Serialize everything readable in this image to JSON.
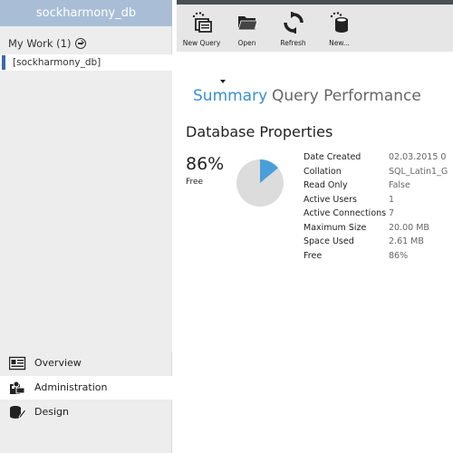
{
  "sidebar": {
    "db_title": "sockharmony_db",
    "my_work_label": "My Work (1)",
    "db_item": "[sockharmony_db]",
    "nav": [
      {
        "label": "Overview",
        "icon": "overview-icon"
      },
      {
        "label": "Administration",
        "icon": "administration-icon"
      },
      {
        "label": "Design",
        "icon": "design-icon"
      }
    ]
  },
  "toolbar": {
    "buttons": [
      {
        "label": "New Query",
        "icon": "new-query-icon"
      },
      {
        "label": "Open",
        "icon": "folder-icon"
      },
      {
        "label": "Refresh",
        "icon": "refresh-icon"
      },
      {
        "label": "New...",
        "icon": "new-database-icon"
      }
    ]
  },
  "main": {
    "tabs": [
      {
        "label": "Summary",
        "active": true
      },
      {
        "label": "Query Performance",
        "active": false
      }
    ],
    "section_title": "Database Properties",
    "free_percent_text": "86%",
    "free_label": "Free",
    "free_fraction": 0.86,
    "properties": [
      {
        "key": "Date Created",
        "value": "02.03.2015 0"
      },
      {
        "key": "Collation",
        "value": "SQL_Latin1_G"
      },
      {
        "key": "Read Only",
        "value": "False"
      },
      {
        "key": "Active Users",
        "value": "1"
      },
      {
        "key": "Active Connections",
        "value": "7"
      },
      {
        "key": "Maximum Size",
        "value": "20.00 MB"
      },
      {
        "key": "Space Used",
        "value": "2.61 MB"
      },
      {
        "key": "Free",
        "value": "86%"
      }
    ]
  },
  "colors": {
    "accent": "#3a8fcf",
    "header_bg": "#a9bed6",
    "pie_used": "#4a9fd8",
    "pie_free": "#dcdcdc"
  }
}
